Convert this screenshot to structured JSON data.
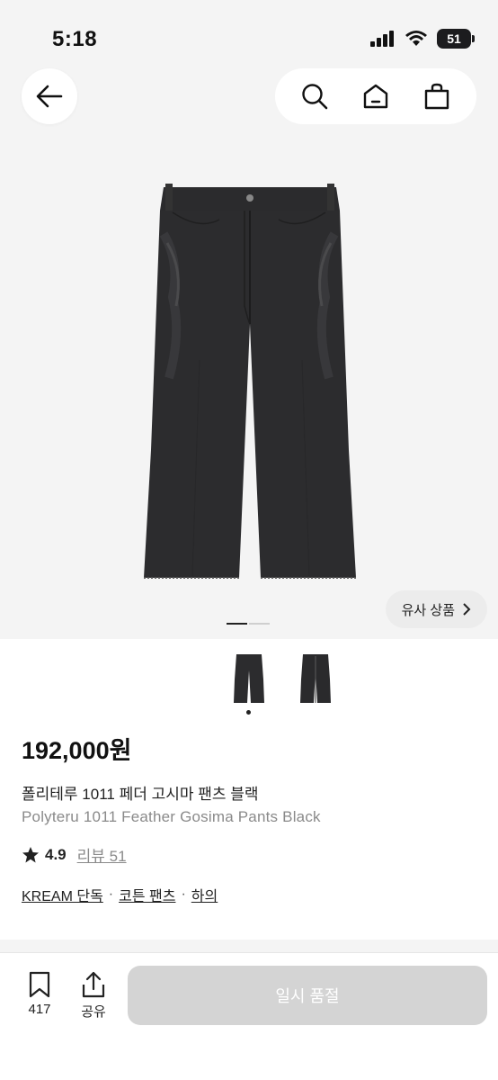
{
  "status_bar": {
    "time": "5:18",
    "battery": "51"
  },
  "nav": {
    "back_icon": "arrow-left-icon",
    "search_icon": "search-icon",
    "home_icon": "home-icon",
    "cart_icon": "shopping-bag-icon"
  },
  "gallery": {
    "similar_label": "유사 상품",
    "slide_count": 2,
    "active_slide": 1
  },
  "product": {
    "price": "192,000원",
    "name_ko": "폴리테루 1011 페더 고시마 팬츠 블랙",
    "name_en": "Polyteru 1011 Feather Gosima Pants Black",
    "rating": "4.9",
    "review_label": "리뷰 51",
    "tags": [
      "KREAM 단독",
      "코튼 팬츠",
      "하의"
    ]
  },
  "bottom_bar": {
    "save_count": "417",
    "share_label": "공유",
    "soldout_label": "일시 품절"
  },
  "colors": {
    "background": "#ffffff",
    "image_bg": "#f4f4f4",
    "disabled_button": "#d4d4d4",
    "muted_text": "#8a8a8a"
  }
}
